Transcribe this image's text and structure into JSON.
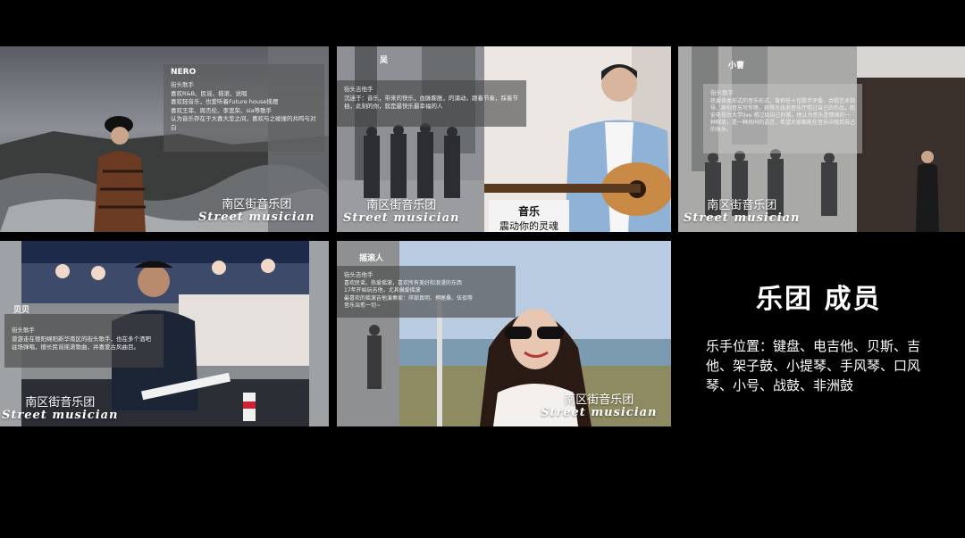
{
  "cards": [
    {
      "name": "NERO",
      "role": "街头歌手",
      "desc": "喜欢R&B、民谣、摇滚、说唱\n喜欢轻音乐，也爱听着Future house摇摆\n喜欢王菲、周杰伦、李宽荣、sia等歌手\n认为音乐存在于大喜大悲之间，喜欢与之碰撞的共鸣与对白",
      "brand_cn": "南区街音乐团",
      "brand_en": "Street musician"
    },
    {
      "name": "吴",
      "role": "街头吉他手",
      "desc": "沉迷于：音乐，带来的快乐，血脉膨胀，的涌动，跟着节奏，踩着节拍，此刻的你，就是最快乐最幸福的人",
      "brand_cn": "南区街音乐团",
      "brand_en": "Street musician",
      "sign_title": "音乐",
      "sign_sub": "震动你的灵魂"
    },
    {
      "name": "小曹",
      "role": "街头歌手",
      "desc": "热爱各类形式的音乐形式，曾担任十佳歌手评委、合唱艺术指导、原创音乐写作等，获得大班南音乐厅唱过自己的作品，西安电视台大学live 唱过给自己的歌。他认为音乐是情绪的一种释放，是一种共同的语言，希望大家都能在音乐中找到自己的快乐。",
      "brand_cn": "南区街音乐团",
      "brand_en": "Street musician"
    },
    {
      "name": "贝贝",
      "role": "街头歌手",
      "desc": "曾游走在德阳绵阳新华南区的街头歌手，也在多个酒吧驻场弹唱，擅长民谣摇滚歌曲，并喜爱古风曲目。",
      "brand_cn": "南区街音乐团",
      "brand_en": "Street musician"
    },
    {
      "name": "摇滚人",
      "role": "街头吉他手",
      "desc": "喜欢民谣，热爱摇滚，喜欢所有美好和浪漫的东西\n17年开始玩吉他，尤其偏爱摇滚\n最喜欢的摇滚吉他演奏家：岸部真明、押尾桑、伍佰等\n音乐治愈一切~",
      "brand_cn": "南区街音乐团",
      "brand_en": "Street musician"
    }
  ],
  "side": {
    "title": "乐团 成员",
    "text": "乐手位置：键盘、电吉他、贝斯、吉他、架子鼓、小提琴、手风琴、口风琴、小号、战鼓、非洲鼓"
  }
}
